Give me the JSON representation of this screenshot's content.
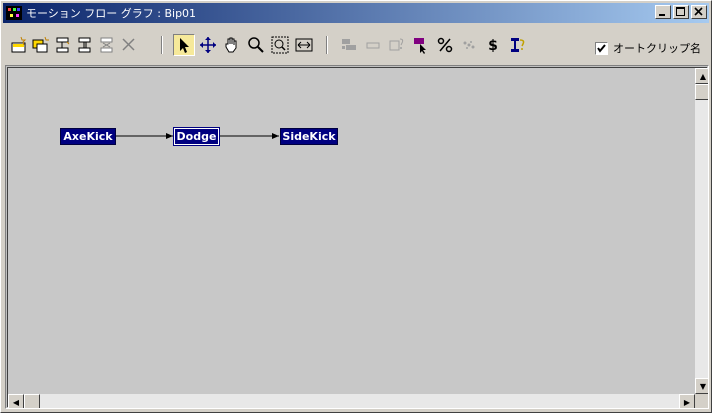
{
  "window": {
    "title": "モーション フロー グラフ : Bip01"
  },
  "title_buttons": [
    "minimize-button",
    "maximize-button",
    "close-button"
  ],
  "toolbar": {
    "tools": [
      {
        "name": "create-clip-icon"
      },
      {
        "name": "create-clips-icon"
      },
      {
        "name": "create-transition-icon"
      },
      {
        "name": "create-transitions-icon"
      },
      {
        "name": "delete-transitions-icon"
      },
      {
        "name": "delete-icon"
      },
      {
        "name": "select-icon",
        "active": true
      },
      {
        "name": "move-icon"
      },
      {
        "name": "pan-icon"
      },
      {
        "name": "zoom-icon"
      },
      {
        "name": "zoom-region-icon"
      },
      {
        "name": "zoom-extents-icon"
      },
      {
        "name": "show-scripts-icon"
      },
      {
        "name": "add-clip-icon"
      },
      {
        "name": "clip-info-icon"
      },
      {
        "name": "select-random-icon"
      },
      {
        "name": "percent-icon"
      },
      {
        "name": "random-start-icon"
      },
      {
        "name": "cost-icon"
      },
      {
        "name": "transition-info-icon"
      }
    ],
    "autoclip_label": "オートクリップ名",
    "autoclip_checked": true
  },
  "graph": {
    "nodes": [
      {
        "label": "AxeKick"
      },
      {
        "label": "Dodge"
      },
      {
        "label": "SideKick"
      }
    ],
    "edges": [
      [
        "AxeKick",
        "Dodge"
      ],
      [
        "Dodge",
        "SideKick"
      ]
    ]
  },
  "colors": {
    "node_bg": "#000080",
    "canvas_bg": "#c8c8c8",
    "title_gradient_start": "#0a246a",
    "title_gradient_end": "#a6caf0"
  }
}
